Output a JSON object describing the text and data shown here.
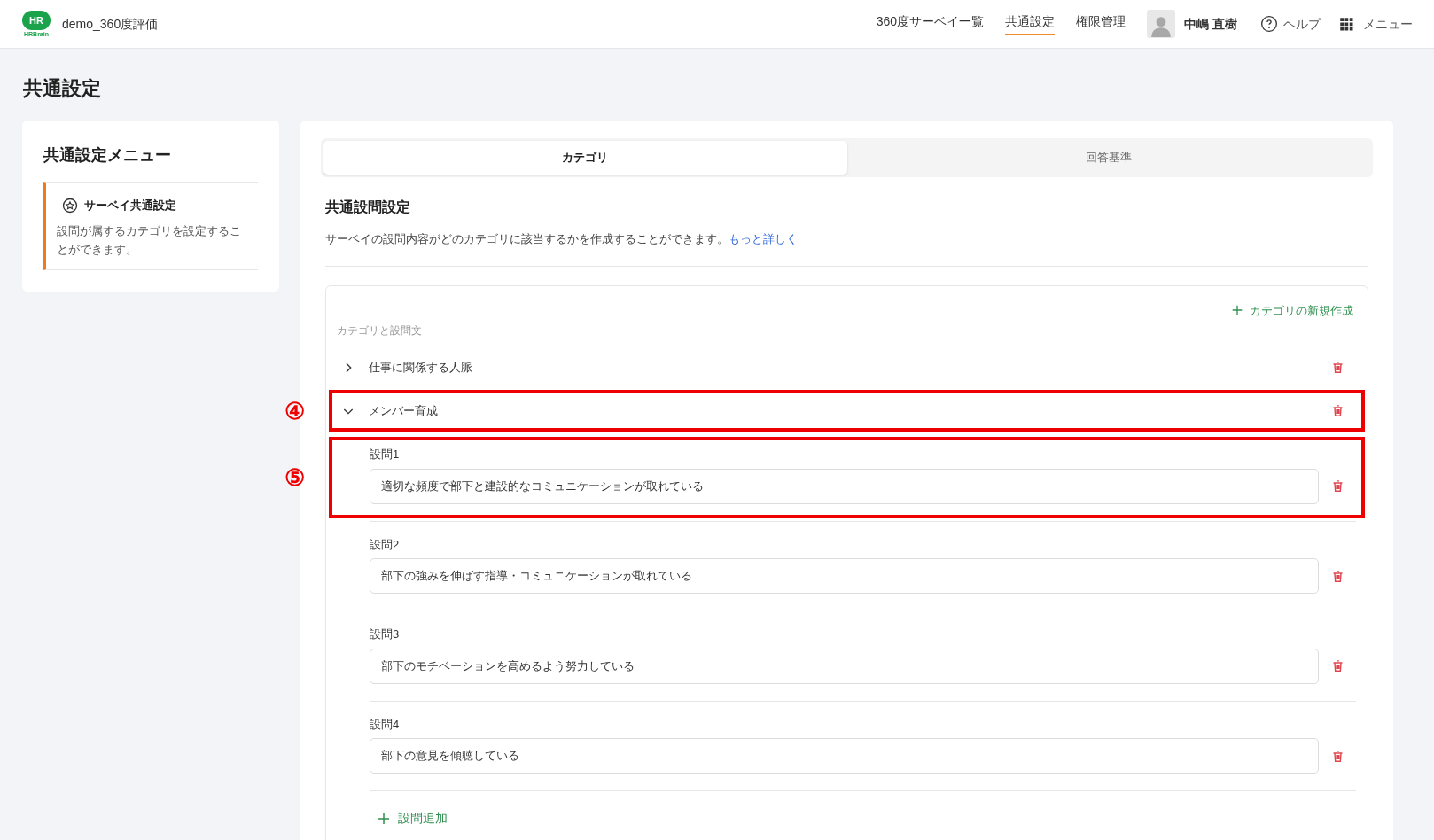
{
  "header": {
    "logo": {
      "mark": "HR",
      "wordmark": "HRBrain"
    },
    "workspace": "demo_360度評価",
    "nav": [
      {
        "label": "360度サーベイ一覧",
        "selected": false
      },
      {
        "label": "共通設定",
        "selected": true
      },
      {
        "label": "権限管理",
        "selected": false
      }
    ],
    "user": "中嶋 直樹",
    "help": "ヘルプ",
    "menu": "メニュー"
  },
  "page_title": "共通設定",
  "sidebar": {
    "title": "共通設定メニュー",
    "items": [
      {
        "label": "サーベイ共通設定",
        "description": "設問が属するカテゴリを設定することができます。",
        "selected": true
      }
    ]
  },
  "tabs": [
    {
      "label": "カテゴリ",
      "selected": true
    },
    {
      "label": "回答基準",
      "selected": false
    }
  ],
  "section": {
    "title": "共通設問設定",
    "description": "サーベイの設問内容がどのカテゴリに該当するかを作成することができます。",
    "link": "もっと詳しく"
  },
  "category_panel": {
    "create_button": "カテゴリの新規作成",
    "column_label": "カテゴリと設問文",
    "categories": [
      {
        "name": "仕事に関係する人脈",
        "expanded": false
      },
      {
        "name": "メンバー育成",
        "expanded": true,
        "annotation": "④",
        "questions": [
          {
            "label": "設問1",
            "value": "適切な頻度で部下と建設的なコミュニケーションが取れている",
            "annotation": "⑤"
          },
          {
            "label": "設問2",
            "value": "部下の強みを伸ばす指導・コミュニケーションが取れている"
          },
          {
            "label": "設問3",
            "value": "部下のモチベーションを高めるよう努力している"
          },
          {
            "label": "設問4",
            "value": "部下の意見を傾聴している"
          }
        ],
        "add_button": "設問追加"
      }
    ]
  }
}
